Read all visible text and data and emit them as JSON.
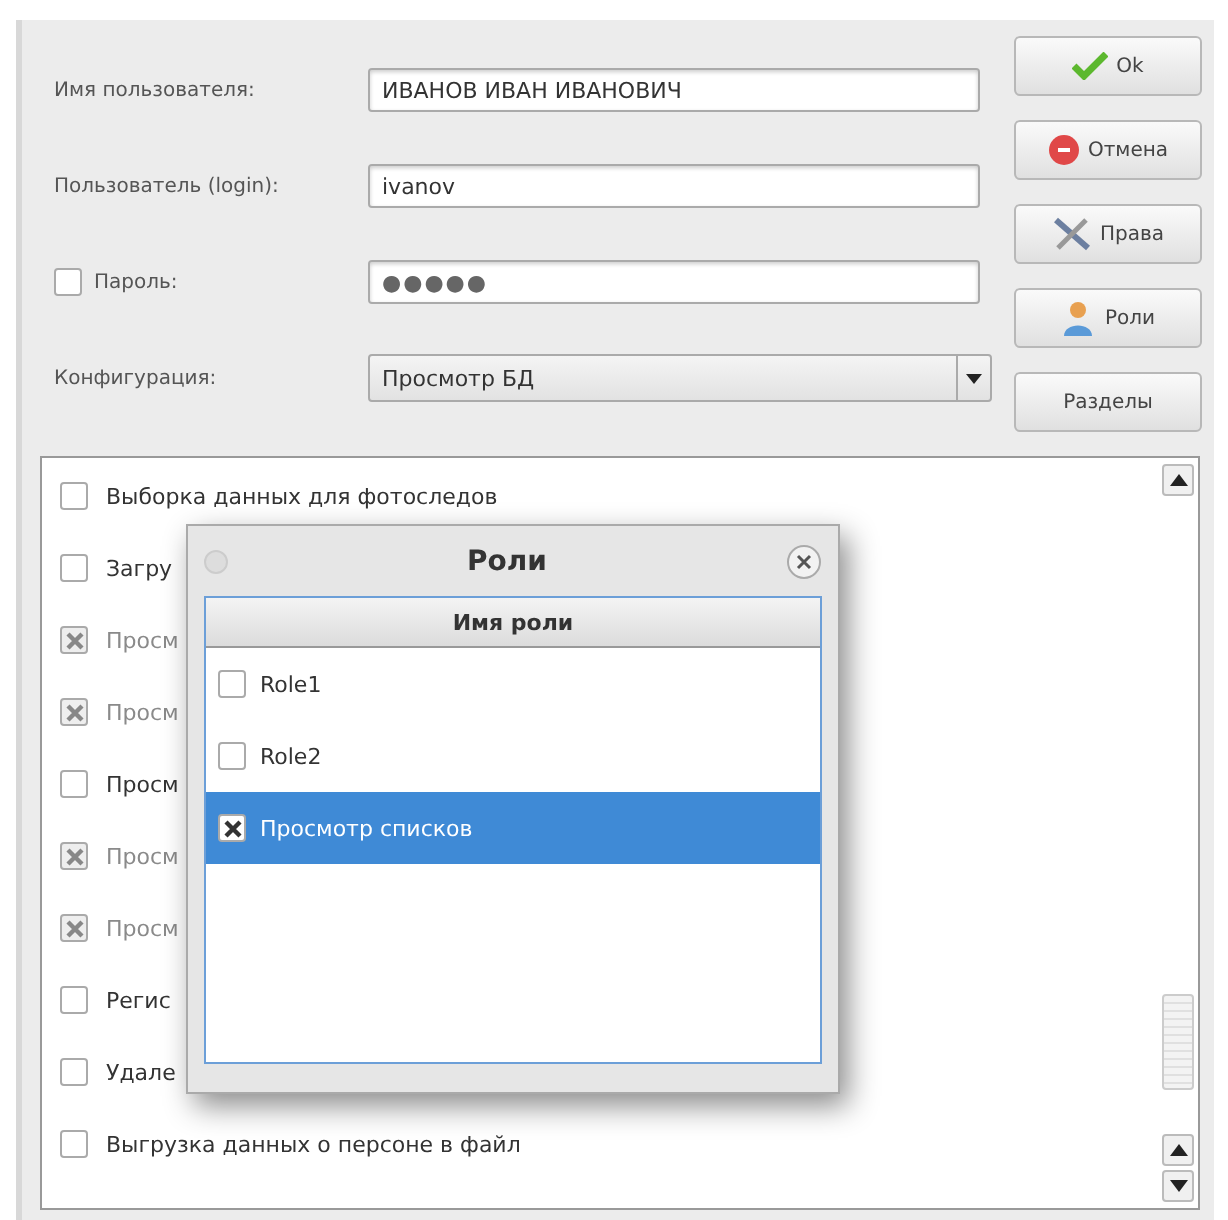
{
  "form": {
    "fields": [
      {
        "kind": "text",
        "label": "Имя пользователя:",
        "value": "ИВАНОВ ИВАН ИВАНОВИЧ"
      },
      {
        "kind": "text",
        "label": "Пользователь (login):",
        "value": "ivanov"
      },
      {
        "kind": "password",
        "label": "Пароль:",
        "value": "●●●●●",
        "checked": false
      },
      {
        "kind": "combo",
        "label": "Конфигурация:",
        "value": "Просмотр БД"
      }
    ]
  },
  "buttons": [
    {
      "label": "Ok"
    },
    {
      "label": "Отмена"
    },
    {
      "label": "Права"
    },
    {
      "label": "Роли"
    },
    {
      "label": "Разделы"
    }
  ],
  "sections": [
    {
      "label": "Выборка данных для фотоследов",
      "checked": false,
      "disabled": false
    },
    {
      "label": "Загру",
      "checked": false,
      "disabled": false
    },
    {
      "label": "Просм",
      "checked": true,
      "disabled": true
    },
    {
      "label": "Просм",
      "checked": true,
      "disabled": true
    },
    {
      "label": "Просм",
      "checked": false,
      "disabled": false
    },
    {
      "label": "Просм",
      "checked": true,
      "disabled": true
    },
    {
      "label": "Просм",
      "checked": true,
      "disabled": true
    },
    {
      "label": "Регис",
      "checked": false,
      "disabled": false
    },
    {
      "label": "Удале",
      "checked": false,
      "disabled": false
    },
    {
      "label": "Выгрузка данных о персоне в файл",
      "checked": false,
      "disabled": false
    }
  ],
  "roles_dialog": {
    "title": "Роли",
    "column": "Имя роли",
    "rows": [
      {
        "label": "Role1",
        "checked": false,
        "selected": false
      },
      {
        "label": "Role2",
        "checked": false,
        "selected": false
      },
      {
        "label": "Просмотр списков",
        "checked": true,
        "selected": true
      }
    ]
  }
}
